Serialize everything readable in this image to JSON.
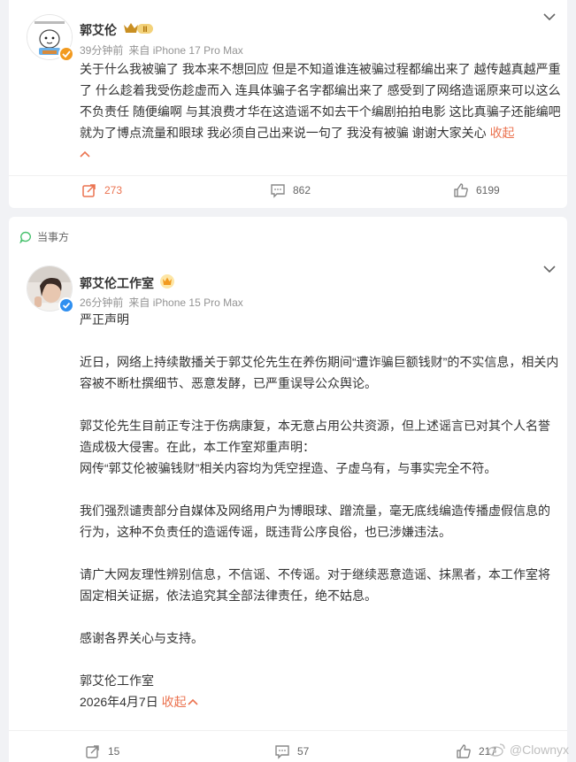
{
  "post1": {
    "author": "郭艾伦",
    "time": "39分钟前",
    "source": "来自 iPhone 17 Pro Max",
    "vip_level": "II",
    "text": "关于什么我被骗了 我本来不想回应 但是不知道谁连被骗过程都编出来了 越传越真越严重了 什么趁着我受伤趁虚而入 连具体骗子名字都编出来了 感受到了网络造谣原来可以这么不负责任 随便编啊 与其浪费才华在这造谣不如去干个编剧拍拍电影 这比真骗子还能编吧 就为了博点流量和眼球 我必须自己出来说一句了 我没有被骗 谢谢大家关心",
    "collapse_label": "收起",
    "reposts": "273",
    "comments": "862",
    "likes": "6199"
  },
  "post2": {
    "party_tag": "当事方",
    "author": "郭艾伦工作室",
    "time": "26分钟前",
    "source": "来自 iPhone 15 Pro Max",
    "paragraphs": [
      "严正声明",
      "近日，网络上持续散播关于郭艾伦先生在养伤期间“遭诈骗巨额钱财”的不实信息，相关内容被不断杜撰细节、恶意发酵，已严重误导公众舆论。",
      "郭艾伦先生目前正专注于伤病康复，本无意占用公共资源，但上述谣言已对其个人名誉造成极大侵害。在此，本工作室郑重声明：",
      "网传“郭艾伦被骗钱财”相关内容均为凭空捏造、子虚乌有，与事实完全不符。",
      "我们强烈谴责部分自媒体及网络用户为博眼球、蹭流量，毫无底线编造传播虚假信息的行为，这种不负责任的造谣传谣，既违背公序良俗，也已涉嫌违法。",
      "请广大网友理性辨别信息，不信谣、不传谣。对于继续恶意造谣、抹黑者，本工作室将固定相关证据，依法追究其全部法律责任，绝不姑息。",
      "感谢各界关心与支持。",
      "郭艾伦工作室",
      "2026年4月7日"
    ],
    "collapse_label": "收起",
    "reposts": "15",
    "comments": "57",
    "likes": "217"
  },
  "watermark": "@Clownyx",
  "icons": {
    "chevron": "chevron-down-icon",
    "repost": "repost-icon",
    "comment": "comment-icon",
    "like": "thumbs-up-icon",
    "verified": "verified-badge-icon",
    "crown": "crown-icon",
    "party": "speech-bubble-icon"
  },
  "colors": {
    "accent": "#eb7350",
    "verified_blue": "#2f8ff0",
    "muted": "#939393",
    "party_green": "#4ac26f"
  }
}
